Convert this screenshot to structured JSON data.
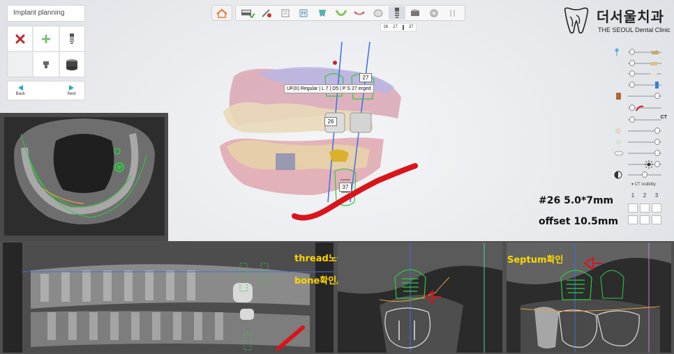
{
  "planning_panel": {
    "title": "Implant planning",
    "tools": [
      {
        "icon": "delete-x-icon",
        "color": "#c0262c"
      },
      {
        "icon": "add-plus-icon",
        "color": "#7cbf7a"
      },
      {
        "icon": "implant-icon",
        "color": "#555555"
      },
      {
        "icon": "empty",
        "color": ""
      },
      {
        "icon": "abutment-icon",
        "color": "#555555"
      },
      {
        "icon": "sleeve-icon",
        "color": "#333333"
      }
    ],
    "back_label": "Back",
    "next_label": "Next"
  },
  "toolbar": {
    "buttons": [
      "scan-icon",
      "tools-icon",
      "segment-icon",
      "tooth-icon",
      "shield-icon",
      "arch-icon",
      "margin-icon",
      "crown-icon",
      "implant-icon",
      "sleeve-icon",
      "disc-icon",
      "multi-icon"
    ],
    "active_index": 8,
    "tooth_numbers": [
      "26",
      "27",
      "37"
    ]
  },
  "logo": {
    "korean": "더서울치과",
    "english": "THE SEOUL Dental Clinic"
  },
  "right_panel": {
    "ct_label": "CT",
    "ct_visibility_label": "CT visibility",
    "view_numbers": [
      "1",
      "2",
      "3"
    ]
  },
  "viewport3d": {
    "tooltip": "UF(II) Regular | L 7 | D5 | P S 27 erged",
    "implant_labels": [
      "26",
      "27",
      "37"
    ]
  },
  "annotations": {
    "spec": "#26 5.0*7mm",
    "offset": "offset 10.5mm",
    "thread": "thread노출",
    "bone": "bone확인/GBR",
    "septum": "Septum확인"
  },
  "colors": {
    "accent": "#2aa5c4",
    "implant_green": "#2ecc40",
    "nerve_red": "#d9141b",
    "annotation_yellow": "#ffd700"
  }
}
